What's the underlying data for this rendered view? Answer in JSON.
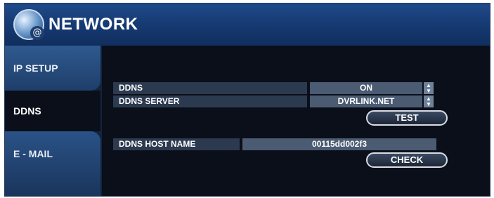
{
  "header": {
    "title": "NETWORK",
    "icon": "globe-at-icon"
  },
  "sidebar": {
    "tabs": [
      {
        "label": "IP SETUP"
      },
      {
        "label": "DDNS"
      },
      {
        "label": "E - MAIL"
      }
    ],
    "active": "DDNS"
  },
  "ddns": {
    "ddns_label": "DDNS",
    "ddns_value": "ON",
    "server_label": "DDNS SERVER",
    "server_value": "DVRLINK.NET",
    "test_button": "TEST",
    "host_label": "DDNS HOST NAME",
    "host_value": "00115dd002f3",
    "check_button": "CHECK"
  },
  "colors": {
    "header": "#163a73",
    "background": "#0a0f1a",
    "label_bg": "#2c3a4f",
    "value_bg": "#4a5b72"
  }
}
